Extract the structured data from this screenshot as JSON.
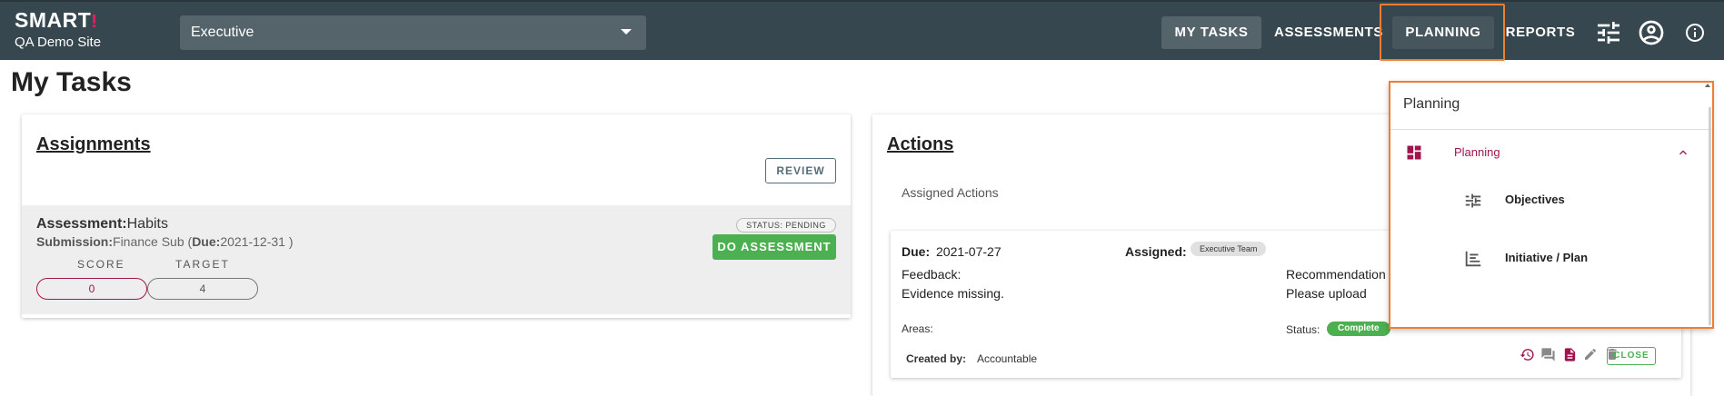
{
  "brand": {
    "logo": "SMART",
    "logo_mark": "!",
    "site": "QA Demo Site"
  },
  "site_selector": {
    "value": "Executive"
  },
  "nav": {
    "my_tasks": "MY TASKS",
    "assessments": "ASSESSMENTS",
    "planning": "PLANNING",
    "reports": "REPORTS"
  },
  "page_title": "My Tasks",
  "assignments": {
    "heading": "Assignments",
    "review_label": "REVIEW",
    "item": {
      "assessment_label": "Assessment:",
      "assessment_value": "Habits",
      "submission_label": "Submission:",
      "submission_value": "Finance Sub (",
      "due_label": "Due:",
      "due_value": "2021-12-31 )",
      "score_label": "SCORE",
      "target_label": "TARGET",
      "score_value": "0",
      "target_value": "4",
      "status": "STATUS: PENDING",
      "do_label": "DO ASSESSMENT"
    }
  },
  "actions": {
    "heading": "Actions",
    "subheading": "Assigned Actions",
    "item": {
      "due_label": "Due:",
      "due_value": "2021-07-27",
      "assigned_label": "Assigned:",
      "assigned_value": "Executive Team",
      "feedback_label": "Feedback:",
      "feedback_value": "Evidence missing.",
      "recommendation_label": "Recommendation",
      "recommendation_value": "Please upload",
      "areas_label": "Areas:",
      "status_label": "Status:",
      "status_value": "Complete",
      "created_label": "Created by:",
      "created_value": "Accountable",
      "close_label": "CLOSE"
    }
  },
  "planning_menu": {
    "title": "Planning",
    "group_label": "Planning",
    "items": [
      {
        "label": "Objectives",
        "icon": "objectives-icon"
      },
      {
        "label": "Initiative / Plan",
        "icon": "initiative-icon"
      }
    ]
  },
  "colors": {
    "topbar": "#37474f",
    "accent": "#a0154f",
    "success": "#4caf50",
    "highlight": "#ef7d32"
  }
}
